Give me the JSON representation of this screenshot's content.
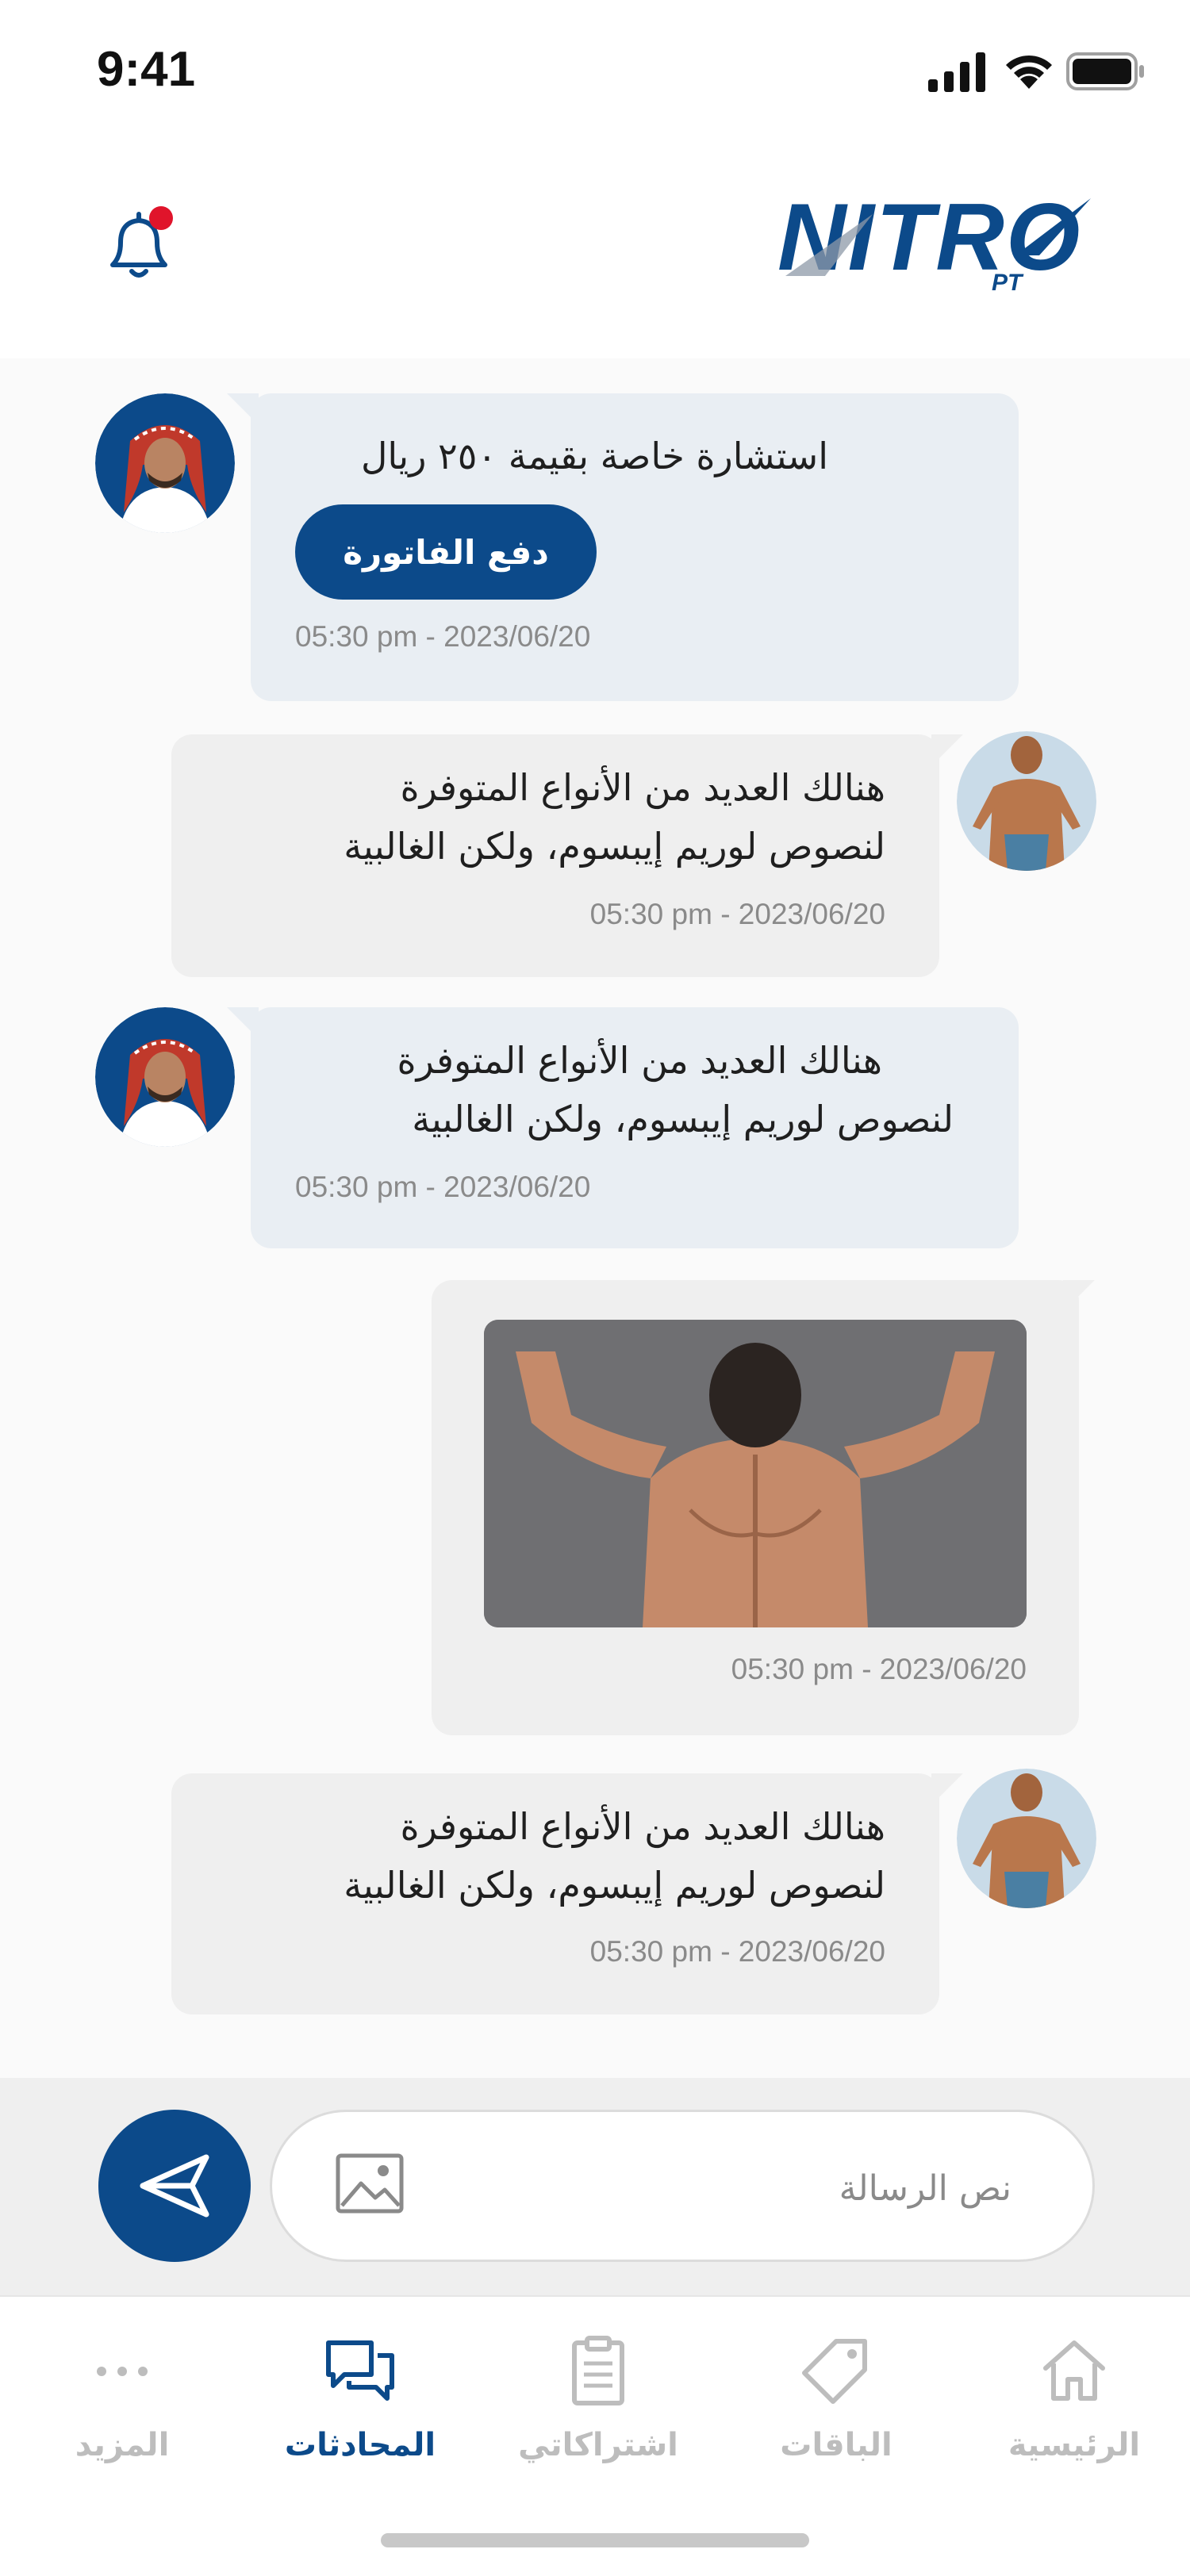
{
  "status_bar": {
    "time": "9:41"
  },
  "header": {
    "logo_text": "NITRO",
    "logo_sub": "PT",
    "brand_color": "#0c4a8a"
  },
  "messages": [
    {
      "id": "m1",
      "side": "coach",
      "text_lines": [
        "استشارة خاصة بقيمة ٢٥٠ ريال"
      ],
      "button_label": "دفع الفاتورة",
      "timestamp": "05:30 pm - 2023/06/20"
    },
    {
      "id": "m2",
      "side": "client",
      "text_lines": [
        "هنالك العديد من الأنواع المتوفرة",
        "لنصوص لوريم إيبسوم، ولكن الغالبية"
      ],
      "timestamp": "05:30 pm - 2023/06/20"
    },
    {
      "id": "m3",
      "side": "coach",
      "text_lines": [
        "هنالك العديد من الأنواع المتوفرة",
        "لنصوص لوريم إيبسوم، ولكن الغالبية"
      ],
      "timestamp": "05:30 pm - 2023/06/20"
    },
    {
      "id": "m4",
      "side": "client-image",
      "timestamp": "05:30 pm - 2023/06/20"
    },
    {
      "id": "m5",
      "side": "client",
      "text_lines": [
        "هنالك العديد من الأنواع المتوفرة",
        "لنصوص لوريم إيبسوم، ولكن الغالبية"
      ],
      "timestamp": "05:30 pm - 2023/06/20"
    }
  ],
  "composer": {
    "placeholder": "نص الرسالة"
  },
  "tabs": [
    {
      "key": "home",
      "label": "الرئيسية",
      "icon": "home-icon",
      "active": false
    },
    {
      "key": "packages",
      "label": "الباقات",
      "icon": "tag-icon",
      "active": false
    },
    {
      "key": "subscriptions",
      "label": "اشتراكاتي",
      "icon": "clipboard-icon",
      "active": false
    },
    {
      "key": "chats",
      "label": "المحادثات",
      "icon": "chat-icon",
      "active": true
    },
    {
      "key": "more",
      "label": "المزيد",
      "icon": "more-icon",
      "active": false
    }
  ],
  "colors": {
    "accent": "#0c4a8a",
    "notification_dot": "#e0142b",
    "coach_bubble": "#e9eef3",
    "client_bubble": "#efefef"
  }
}
